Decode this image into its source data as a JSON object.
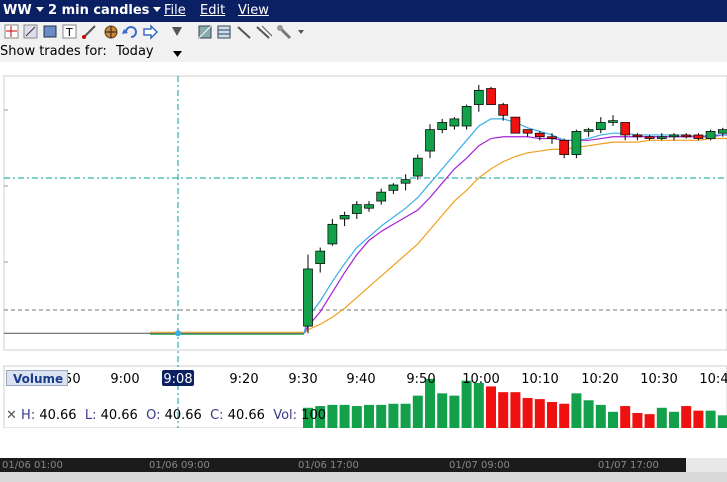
{
  "window": {
    "symbol": "WW",
    "interval": "2 min candles",
    "menu": [
      "File",
      "Edit",
      "View"
    ]
  },
  "toolbar": {
    "icons": [
      "crosshair-icon",
      "draw-line-icon",
      "rectangle-icon",
      "text-icon",
      "trend-icon",
      "target-icon",
      "undo-icon",
      "forward-icon",
      "filter-icon",
      "grid-pattern-icon",
      "fib-icon",
      "ray-icon",
      "channel-icon",
      "wrench-icon",
      "more-icon"
    ]
  },
  "trades": {
    "label": "Show trades for:",
    "value": "Today"
  },
  "info": {
    "h_label": "H:",
    "h": "40.66",
    "l_label": "L:",
    "l": "40.66",
    "o_label": "O:",
    "o": "40.66",
    "c_label": "C:",
    "c": "40.66",
    "vol_label": "Vol:",
    "vol": "100"
  },
  "volume_label": "Volume",
  "time_axis": [
    "8:50",
    "9:00",
    "9:08",
    "9:20",
    "9:30",
    "9:40",
    "9:50",
    "10:00",
    "10:10",
    "10:20",
    "10:30",
    "10:4"
  ],
  "cursor_time": "9:08",
  "scroll_labels": [
    "01/06 01:00",
    "01/06 09:00",
    "01/06 17:00",
    "01/07 09:00",
    "01/07 17:00"
  ],
  "colors": {
    "up": "#12a04a",
    "down": "#ef1010",
    "ma_fast": "#3aaee8",
    "ma_mid": "#a520d8",
    "ma_slow": "#f0a020",
    "crosshair": "#00a0a0",
    "titlebar": "#0b1f63"
  },
  "chart_data": {
    "type": "candlestick",
    "candles": [
      {
        "t": "9:30",
        "o": 40.7,
        "h": 41.1,
        "l": 40.66,
        "c": 41.02
      },
      {
        "t": "9:32",
        "o": 41.05,
        "h": 41.14,
        "l": 41.0,
        "c": 41.12
      },
      {
        "t": "9:34",
        "o": 41.16,
        "h": 41.3,
        "l": 41.15,
        "c": 41.27
      },
      {
        "t": "9:36",
        "o": 41.3,
        "h": 41.34,
        "l": 41.26,
        "c": 41.32
      },
      {
        "t": "9:38",
        "o": 41.33,
        "h": 41.4,
        "l": 41.3,
        "c": 41.38
      },
      {
        "t": "9:40",
        "o": 41.36,
        "h": 41.4,
        "l": 41.34,
        "c": 41.38
      },
      {
        "t": "9:42",
        "o": 41.4,
        "h": 41.47,
        "l": 41.38,
        "c": 41.45
      },
      {
        "t": "9:44",
        "o": 41.46,
        "h": 41.5,
        "l": 41.44,
        "c": 41.49
      },
      {
        "t": "9:46",
        "o": 41.5,
        "h": 41.55,
        "l": 41.46,
        "c": 41.52
      },
      {
        "t": "9:48",
        "o": 41.54,
        "h": 41.66,
        "l": 41.52,
        "c": 41.64
      },
      {
        "t": "9:50",
        "o": 41.68,
        "h": 41.83,
        "l": 41.64,
        "c": 41.8
      },
      {
        "t": "9:52",
        "o": 41.8,
        "h": 41.86,
        "l": 41.78,
        "c": 41.84
      },
      {
        "t": "9:54",
        "o": 41.82,
        "h": 41.87,
        "l": 41.8,
        "c": 41.86
      },
      {
        "t": "9:56",
        "o": 41.82,
        "h": 41.94,
        "l": 41.8,
        "c": 41.93
      },
      {
        "t": "9:58",
        "o": 41.94,
        "h": 42.05,
        "l": 41.9,
        "c": 42.02
      },
      {
        "t": "10:00",
        "o": 42.03,
        "h": 42.04,
        "l": 41.94,
        "c": 41.94
      },
      {
        "t": "10:02",
        "o": 41.94,
        "h": 41.95,
        "l": 41.85,
        "c": 41.88
      },
      {
        "t": "10:04",
        "o": 41.87,
        "h": 41.87,
        "l": 41.78,
        "c": 41.78
      },
      {
        "t": "10:06",
        "o": 41.8,
        "h": 41.8,
        "l": 41.76,
        "c": 41.78
      },
      {
        "t": "10:08",
        "o": 41.78,
        "h": 41.79,
        "l": 41.74,
        "c": 41.76
      },
      {
        "t": "10:10",
        "o": 41.76,
        "h": 41.78,
        "l": 41.72,
        "c": 41.75
      },
      {
        "t": "10:12",
        "o": 41.74,
        "h": 41.75,
        "l": 41.64,
        "c": 41.66
      },
      {
        "t": "10:14",
        "o": 41.66,
        "h": 41.8,
        "l": 41.64,
        "c": 41.79
      },
      {
        "t": "10:16",
        "o": 41.79,
        "h": 41.81,
        "l": 41.76,
        "c": 41.8
      },
      {
        "t": "10:18",
        "o": 41.8,
        "h": 41.87,
        "l": 41.78,
        "c": 41.84
      },
      {
        "t": "10:20",
        "o": 41.84,
        "h": 41.88,
        "l": 41.82,
        "c": 41.85
      },
      {
        "t": "10:22",
        "o": 41.84,
        "h": 41.84,
        "l": 41.74,
        "c": 41.77
      },
      {
        "t": "10:24",
        "o": 41.77,
        "h": 41.78,
        "l": 41.74,
        "c": 41.76
      },
      {
        "t": "10:26",
        "o": 41.76,
        "h": 41.77,
        "l": 41.74,
        "c": 41.75
      },
      {
        "t": "10:28",
        "o": 41.75,
        "h": 41.78,
        "l": 41.74,
        "c": 41.76
      },
      {
        "t": "10:30",
        "o": 41.76,
        "h": 41.78,
        "l": 41.74,
        "c": 41.77
      },
      {
        "t": "10:32",
        "o": 41.77,
        "h": 41.78,
        "l": 41.75,
        "c": 41.76
      },
      {
        "t": "10:34",
        "o": 41.77,
        "h": 41.78,
        "l": 41.74,
        "c": 41.75
      },
      {
        "t": "10:36",
        "o": 41.75,
        "h": 41.8,
        "l": 41.74,
        "c": 41.79
      },
      {
        "t": "10:38",
        "o": 41.78,
        "h": 41.81,
        "l": 41.76,
        "c": 41.8
      },
      {
        "t": "10:40",
        "o": 41.78,
        "h": 41.81,
        "l": 41.76,
        "c": 41.81
      }
    ],
    "volumes": [
      35,
      38,
      40,
      40,
      38,
      40,
      40,
      42,
      42,
      56,
      85,
      60,
      56,
      82,
      78,
      72,
      62,
      62,
      52,
      50,
      45,
      42,
      60,
      48,
      40,
      28,
      38,
      26,
      24,
      35,
      28,
      38,
      30,
      30,
      22,
      26
    ],
    "ma_fast": [
      40.75,
      40.84,
      40.95,
      41.05,
      41.14,
      41.2,
      41.26,
      41.31,
      41.36,
      41.42,
      41.5,
      41.58,
      41.66,
      41.74,
      41.82,
      41.86,
      41.86,
      41.84,
      41.81,
      41.79,
      41.77,
      41.74,
      41.74,
      41.75,
      41.77,
      41.78,
      41.78,
      41.77,
      41.77,
      41.77,
      41.77,
      41.77,
      41.76,
      41.77,
      41.77,
      41.78
    ],
    "ma_mid": [
      40.7,
      40.78,
      40.89,
      41.0,
      41.1,
      41.18,
      41.23,
      41.27,
      41.31,
      41.35,
      41.42,
      41.5,
      41.58,
      41.64,
      41.71,
      41.75,
      41.76,
      41.76,
      41.76,
      41.75,
      41.75,
      41.74,
      41.74,
      41.74,
      41.75,
      41.76,
      41.76,
      41.76,
      41.76,
      41.76,
      41.76,
      41.76,
      41.76,
      41.76,
      41.77,
      41.77
    ],
    "ma_slow": [
      40.68,
      40.71,
      40.75,
      40.8,
      40.86,
      40.92,
      40.98,
      41.04,
      41.1,
      41.16,
      41.24,
      41.32,
      41.4,
      41.46,
      41.53,
      41.58,
      41.62,
      41.65,
      41.67,
      41.68,
      41.69,
      41.69,
      41.7,
      41.71,
      41.72,
      41.73,
      41.73,
      41.73,
      41.74,
      41.74,
      41.74,
      41.74,
      41.74,
      41.75,
      41.75,
      41.75
    ],
    "baseline_price": 40.66,
    "ylim": [
      40.6,
      42.1
    ],
    "vol_max": 90
  }
}
